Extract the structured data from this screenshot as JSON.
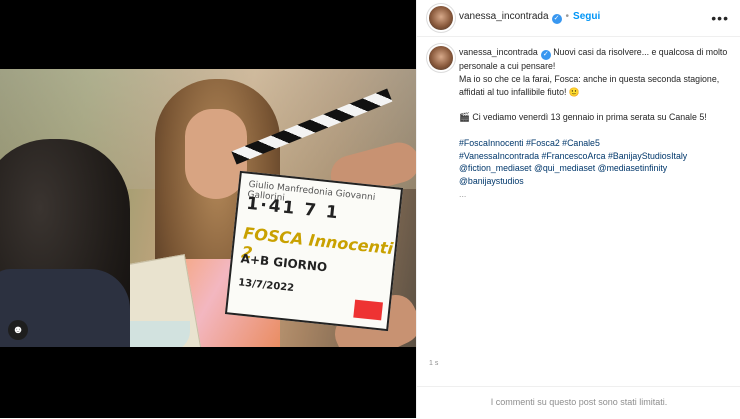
{
  "post": {
    "username": "vanessa_incontrada",
    "follow_label": "Segui",
    "more_icon": "more-horizontal-icon",
    "verified_icon": "verified-badge-icon"
  },
  "caption": {
    "username": "vanessa_incontrada",
    "line1": "Nuovi casi da risolvere... e qualcosa di molto personale a cui pensare!",
    "line2": "Ma io so che ce la farai, Fosca: anche in questa seconda stagione, affidati al tuo infallibile fiuto!",
    "line2_emoji": "🙂",
    "line3_emoji": "🎬",
    "line3": "Ci vediamo venerdì 13 gennaio in prima serata su Canale 5!",
    "hashtags1": "#FoscaInnocenti #Fosca2 #Canale5",
    "hashtags2": "#VanessaIncontrada #FrancescoArca #BanijayStudiosItaly",
    "mentions1": "@fiction_mediaset @qui_mediaset @mediasetinfinity",
    "mentions2": "@banijaystudios",
    "ellipsis": "..."
  },
  "clapperboard": {
    "label_top": "Giulio Manfredonia   Giovanni Gallorini",
    "numbers": "1·41  7  1",
    "title": "FOSCA Innocenti 2",
    "scene": "A+B  GIORNO",
    "date": "13/7/2022"
  },
  "meta": {
    "likes_time": "1 s",
    "comments_disabled": "I commenti su questo post sono stati limitati."
  },
  "media_icon": "person-tag-icon",
  "colors": {
    "link": "#0095f6",
    "hashtag": "#00376b",
    "verified": "#3897f0"
  }
}
